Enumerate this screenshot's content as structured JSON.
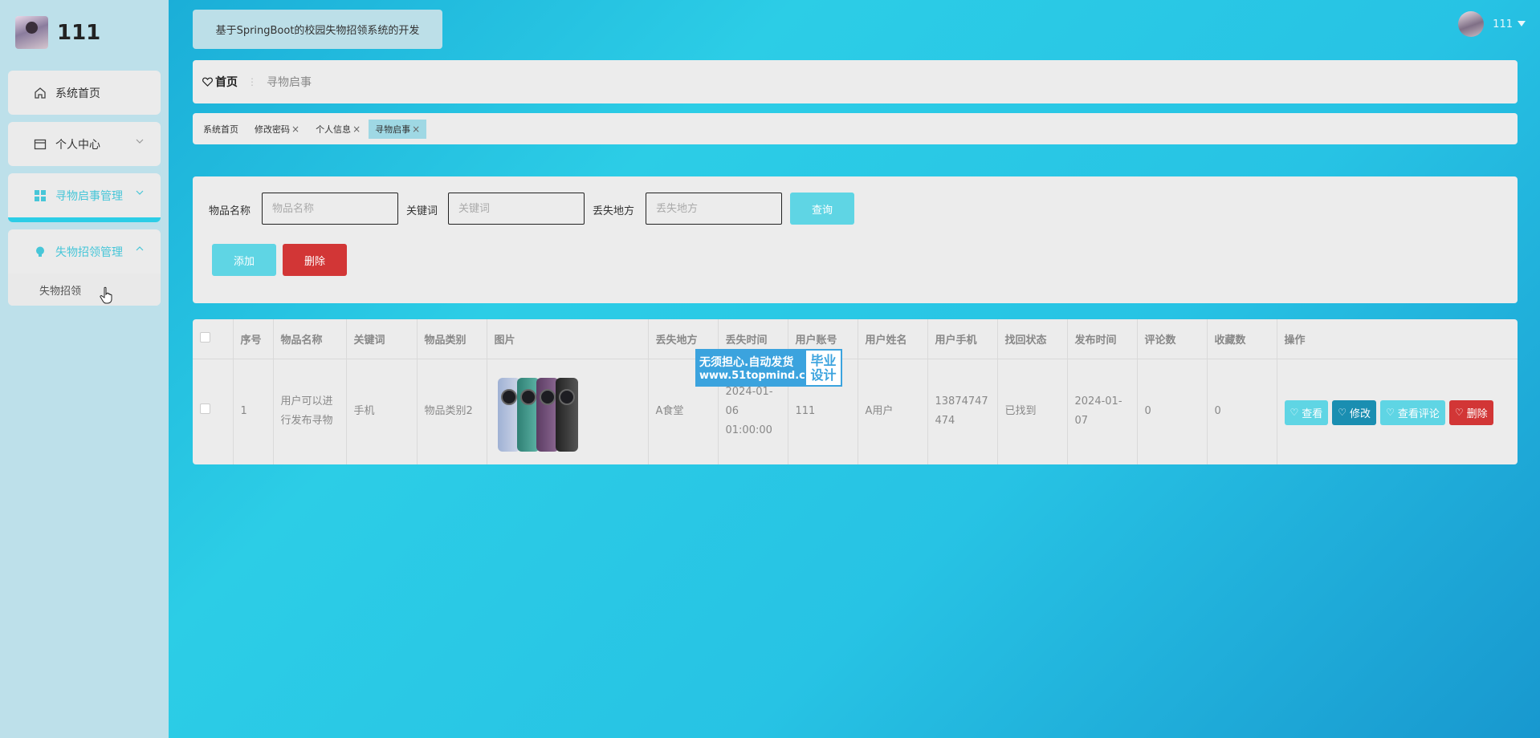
{
  "sidebar": {
    "brand_title": "111",
    "items": [
      {
        "label": "系统首页",
        "icon": "home-icon"
      },
      {
        "label": "个人中心",
        "icon": "card-icon"
      },
      {
        "label": "寻物启事管理",
        "icon": "grid-icon"
      },
      {
        "label": "失物招领管理",
        "icon": "bulb-icon",
        "sub": [
          "失物招领"
        ]
      }
    ]
  },
  "header": {
    "system_title": "基于SpringBoot的校园失物招领系统的开发",
    "username": "111"
  },
  "breadcrumb": {
    "home": "首页",
    "current": "寻物启事"
  },
  "tags": [
    {
      "label": "系统首页",
      "closable": false
    },
    {
      "label": "修改密码",
      "closable": true
    },
    {
      "label": "个人信息",
      "closable": true
    },
    {
      "label": "寻物启事",
      "closable": true,
      "active": true
    }
  ],
  "search": {
    "name_label": "物品名称",
    "name_placeholder": "物品名称",
    "keyword_label": "关键词",
    "keyword_placeholder": "关键词",
    "place_label": "丢失地方",
    "place_placeholder": "丢失地方",
    "query_button": "查询",
    "add_button": "添加",
    "delete_button": "删除"
  },
  "table": {
    "columns": [
      "序号",
      "物品名称",
      "关键词",
      "物品类别",
      "图片",
      "丢失地方",
      "丢失时间",
      "用户账号",
      "用户姓名",
      "用户手机",
      "找回状态",
      "发布时间",
      "评论数",
      "收藏数",
      "操作"
    ],
    "rows": [
      {
        "index": "1",
        "item_name": "用户可以进行发布寻物",
        "keyword": "手机",
        "category": "物品类别2",
        "place": "A食堂",
        "lost_time": "2024-01-06 01:00:00",
        "account": "111",
        "user_name": "A用户",
        "phone": "13874747474",
        "status": "已找到",
        "publish_time": "2024-01-07",
        "comments": "0",
        "favorites": "0"
      }
    ],
    "ops": {
      "view": "查看",
      "edit": "修改",
      "comments": "查看评论",
      "delete": "删除"
    }
  },
  "watermark": {
    "line1": "无须担心.自动发货",
    "line2": "www.51topmind.com",
    "badge_top": "毕业",
    "badge_bottom": "设计"
  },
  "colors": {
    "accent": "#5fd5e4",
    "edit": "#1a8eb1",
    "danger": "#d23636",
    "sidebar_bg": "#bde0ea"
  }
}
